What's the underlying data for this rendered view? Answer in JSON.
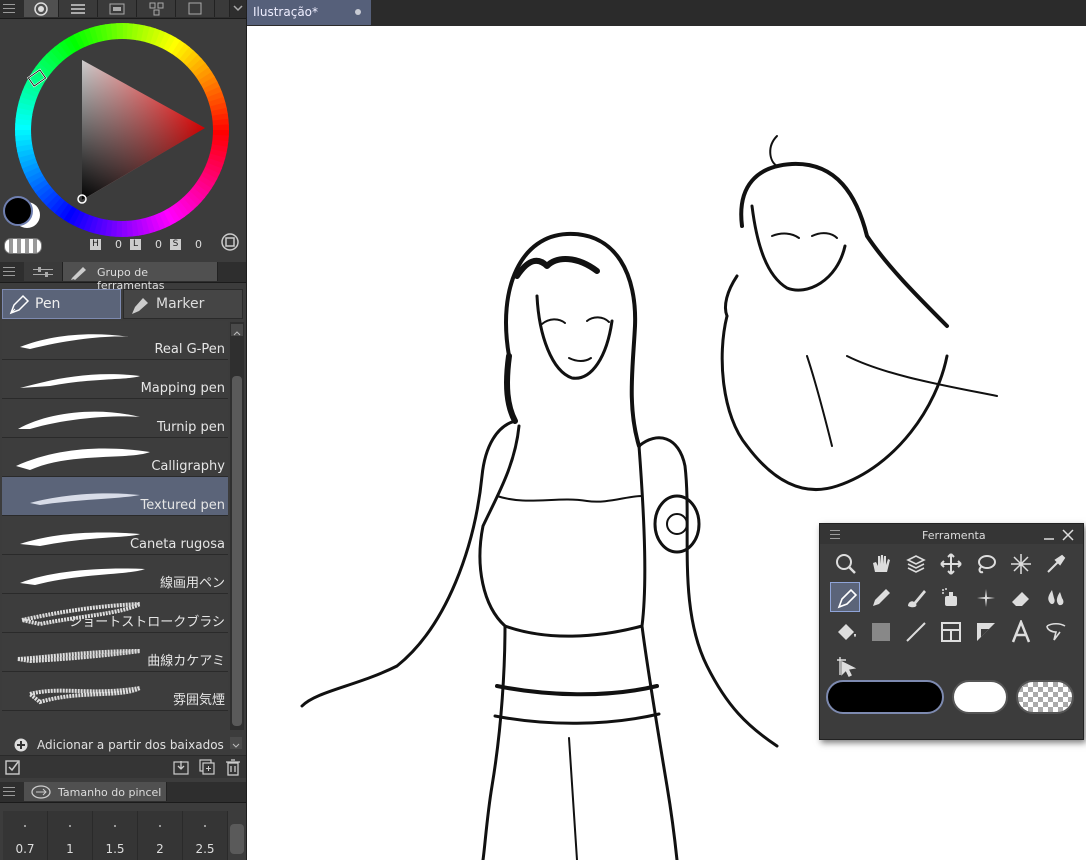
{
  "colors": {
    "panel": "#3c3c3c",
    "selected": "#5b6479",
    "canvas": "#ffffff",
    "main_color": "#000000",
    "sub_color": "#ffffff"
  },
  "color_panel": {
    "hsl_labels": {
      "h": "H",
      "l": "L",
      "s": "S"
    },
    "hsl_values": {
      "h": "0",
      "l": "0",
      "s": "0"
    }
  },
  "tool_group_panel": {
    "title": "Grupo de ferramentas",
    "tabs": [
      {
        "label": "Pen",
        "icon": "pen-icon"
      },
      {
        "label": "Marker",
        "icon": "marker-icon"
      }
    ],
    "selected_tab": "Pen"
  },
  "brushes": [
    {
      "label": "Real G-Pen"
    },
    {
      "label": "Mapping pen"
    },
    {
      "label": "Turnip pen"
    },
    {
      "label": "Calligraphy"
    },
    {
      "label": "Textured pen",
      "selected": true
    },
    {
      "label": "Caneta rugosa"
    },
    {
      "label": "線画用ペン"
    },
    {
      "label": "ショートストロークブラシ"
    },
    {
      "label": "曲線カケアミ"
    },
    {
      "label": "雰囲気煙"
    }
  ],
  "add_downloads": {
    "label": "Adicionar a partir dos baixados"
  },
  "brush_size_panel": {
    "title": "Tamanho do pincel",
    "sizes": [
      "0.7",
      "1",
      "1.5",
      "2",
      "2.5"
    ]
  },
  "document": {
    "tab_title": "Ilustração*"
  },
  "tool_palette": {
    "title": "Ferramenta",
    "tools": [
      "zoom-icon",
      "hand-icon",
      "layer-select-icon",
      "move-icon",
      "lasso-icon",
      "magic-wand-icon",
      "eyedropper-icon",
      "pen-icon",
      "pencil-icon",
      "brush-icon",
      "airbrush-icon",
      "decoration-icon",
      "eraser-icon",
      "blend-icon",
      "fill-icon",
      "gradient-icon",
      "line-icon",
      "frame-icon",
      "ruler-icon",
      "text-icon",
      "balloon-icon",
      "operation-icon"
    ],
    "selected_tool": "pen-icon"
  }
}
